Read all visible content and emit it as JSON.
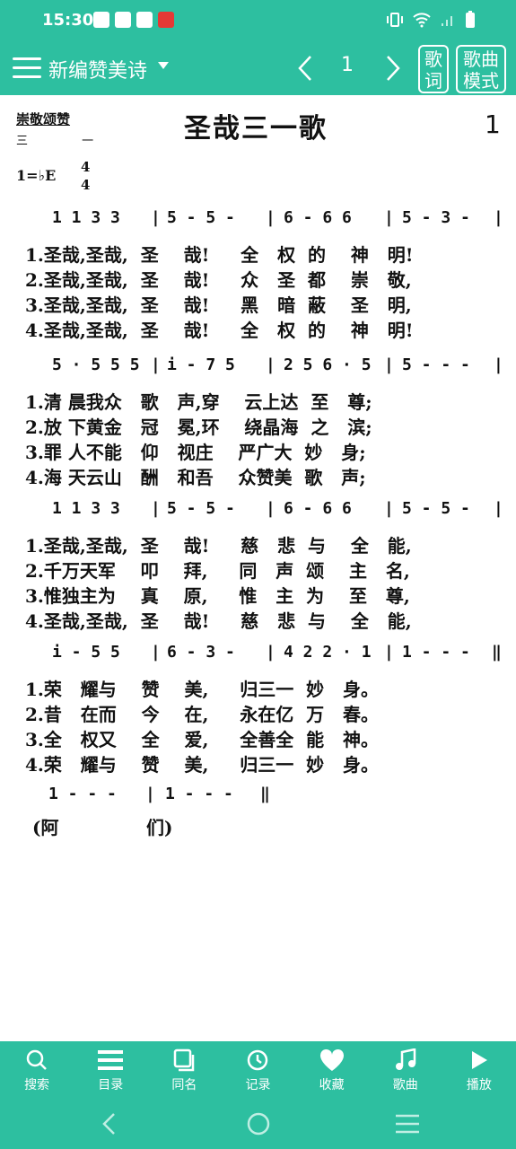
{
  "status_bar": {
    "time": "15:30"
  },
  "app_bar": {
    "menu_icon": "hamburger-icon",
    "title": "新编赞美诗",
    "page_number": "1",
    "lyric_button": "歌词",
    "mode_button": "歌曲模式"
  },
  "sheet": {
    "category": "崇敬颂赞",
    "category_number": "三 一",
    "title": "圣哉三一歌",
    "number": "1",
    "key": "1=♭E",
    "time_top": "4",
    "time_bottom": "4",
    "systems": [
      {
        "notes": [
          "1 1 3 3",
          "5 - 5 -",
          "6 - 6 6",
          "5 - 3 -"
        ],
        "lyrics": [
          "1.圣哉,圣哉,  圣    哉!     全   权  的    神   明!",
          "2.圣哉,圣哉,  圣    哉!     众   圣  都    崇   敬,",
          "3.圣哉,圣哉,  圣    哉!     黑   暗  蔽    圣   明,",
          "4.圣哉,圣哉,  圣    哉!     全   权  的    神   明!"
        ]
      },
      {
        "notes": [
          "5 · 5 5 5",
          "i - 7 5",
          "2 5 6 · 5",
          "5 - - -"
        ],
        "lyrics": [
          "1.清 晨我众   歌   声,穿    云上达  至   尊;",
          "2.放 下黄金   冠   冕,环    绕晶海  之   滨;",
          "3.罪 人不能   仰   视庄    严广大  妙   身;",
          "4.海 天云山   酬   和吾    众赞美  歌   声;"
        ]
      },
      {
        "notes": [
          "1 1 3 3",
          "5 - 5 -",
          "6 - 6 6",
          "5 - 5 -"
        ],
        "lyrics": [
          "1.圣哉,圣哉,  圣    哉!     慈   悲  与    全   能,",
          "2.千万天军    叩    拜,     同   声  颂    主   名,",
          "3.惟独主为    真    原,     惟   主  为    至   尊,",
          "4.圣哉,圣哉,  圣    哉!     慈   悲  与    全   能,"
        ]
      },
      {
        "notes": [
          "i - 5 5",
          "6 - 3 -",
          "4 2 2 · 1",
          "1 - - -"
        ],
        "lyrics": [
          "1.荣   耀与    赞    美,     归三一  妙   身。",
          "2.昔   在而    今    在,     永在亿  万   春。",
          "3.全   权又    全    爱,     全善全  能   神。",
          "4.荣   耀与    赞    美,     归三一  妙   身。"
        ]
      }
    ],
    "amen": {
      "notes": [
        "1 - - -",
        "1 - - -"
      ],
      "lyrics": "(阿              们)"
    }
  },
  "bottom_nav": [
    {
      "label": "搜索",
      "icon": "search-icon"
    },
    {
      "label": "目录",
      "icon": "list-icon"
    },
    {
      "label": "同名",
      "icon": "copy-icon"
    },
    {
      "label": "记录",
      "icon": "history-icon"
    },
    {
      "label": "收藏",
      "icon": "heart-icon"
    },
    {
      "label": "歌曲",
      "icon": "music-note-icon"
    },
    {
      "label": "播放",
      "icon": "play-icon"
    }
  ]
}
